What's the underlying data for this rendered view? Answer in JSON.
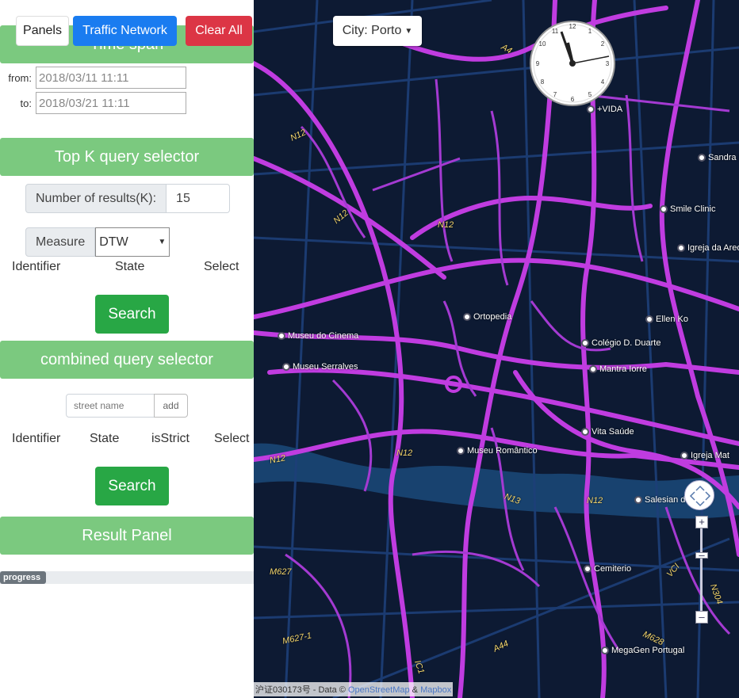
{
  "toolbar": {
    "panels_label": "Panels",
    "traffic_label": "Traffic Network",
    "clear_label": "Clear All",
    "city_label": "City: Porto"
  },
  "time_span": {
    "title": "Time span",
    "from_label": "from:",
    "from_value": "2018/03/11 11:11",
    "to_label": "to:",
    "to_value": "2018/03/21 11:11"
  },
  "topk": {
    "title": "Top K query selector",
    "k_label": "Number of results(K):",
    "k_value": "15",
    "measure_label": "Measure",
    "measure_value": "DTW",
    "columns": [
      "Identifier",
      "State",
      "Select"
    ],
    "search_label": "Search"
  },
  "combined": {
    "title": "combined query selector",
    "street_placeholder": "street name",
    "add_label": "add",
    "columns": [
      "Identifier",
      "State",
      "isStrict",
      "Select"
    ],
    "search_label": "Search"
  },
  "result": {
    "title": "Result Panel",
    "progress_label": "progress",
    "progress_fraction": 0.18
  },
  "map": {
    "pois": [
      "+VIDA",
      "Sandra Sousa",
      "Smile Clinic",
      "Igreja da Areosa",
      "Ellen Ko",
      "Colégio D. Duarte",
      "Mantra Iorre",
      "Museu do Cinema",
      "Museu Serralves",
      "Ortopedia",
      "Vita Saúde",
      "Museu Romântico",
      "Salesian do Porto",
      "Cemiterio",
      "MegaGen Portugal",
      "Igreja Mat"
    ],
    "roads": [
      "N12",
      "N12",
      "N12",
      "N12",
      "N12",
      "N12",
      "N13",
      "A4",
      "IC1",
      "A44",
      "M627",
      "M627-1",
      "M628",
      "N304",
      "VCI"
    ],
    "attribution_prefix": "沪证030173号 - Data ©",
    "attribution_osm": "OpenStreetMap",
    "attribution_amp": "&",
    "attribution_mapbox": "Mapbox"
  }
}
